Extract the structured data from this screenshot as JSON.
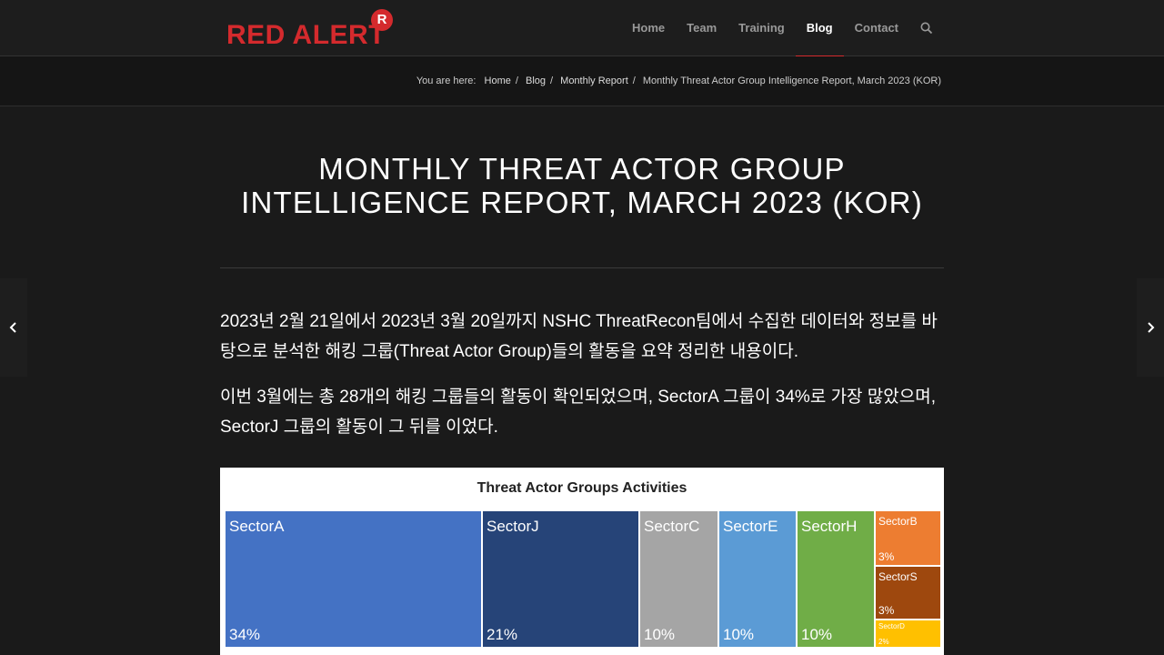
{
  "header": {
    "logo_text": "RED ALERT",
    "logo_badge": "R",
    "nav": [
      "Home",
      "Team",
      "Training",
      "Blog",
      "Contact"
    ],
    "active_nav": "Blog"
  },
  "breadcrumb": {
    "label": "You are here:",
    "items": [
      "Home",
      "Blog",
      "Monthly Report",
      "Monthly Threat Actor Group Intelligence Report, March 2023 (KOR)"
    ]
  },
  "article": {
    "title": "MONTHLY THREAT ACTOR GROUP INTELLIGENCE REPORT, MARCH 2023 (KOR)",
    "paragraphs": [
      "2023년 2월 21일에서 2023년 3월 20일까지 NSHC ThreatRecon팀에서 수집한 데이터와 정보를 바탕으로 분석한 해킹 그룹(Threat Actor Group)들의 활동을 요약 정리한 내용이다.",
      "이번 3월에는 총 28개의 해킹 그룹들의 활동이 확인되었으며, SectorA 그룹이 34%로 가장 많았으며, SectorJ 그룹의 활동이 그 뒤를 이었다."
    ]
  },
  "chart_data": {
    "type": "treemap",
    "title": "Threat Actor Groups Activities",
    "items": [
      {
        "name": "SectorA",
        "label": "34%",
        "value": 34,
        "color": "#4472c4"
      },
      {
        "name": "SectorJ",
        "label": "21%",
        "value": 21,
        "color": "#264478"
      },
      {
        "name": "SectorC",
        "label": "10%",
        "value": 10,
        "color": "#a5a5a5"
      },
      {
        "name": "SectorE",
        "label": "10%",
        "value": 10,
        "color": "#5b9bd5"
      },
      {
        "name": "SectorH",
        "label": "10%",
        "value": 10,
        "color": "#70ad47"
      },
      {
        "name": "SectorB",
        "label": "3%",
        "value": 3,
        "color": "#ed7d31"
      },
      {
        "name": "SectorS",
        "label": "3%",
        "value": 3,
        "color": "#9e480e"
      },
      {
        "name": "SectorD",
        "label": "2%",
        "value": 2,
        "color": "#ffc000"
      }
    ]
  },
  "colors": {
    "accent": "#d42a2d",
    "background": "#1a1a1a"
  }
}
